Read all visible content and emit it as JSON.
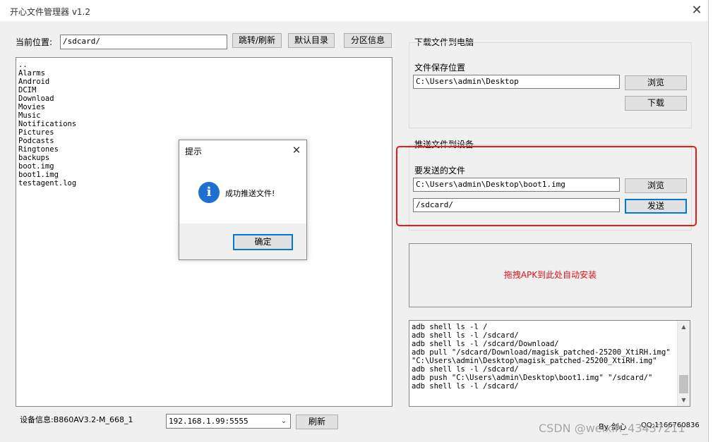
{
  "window": {
    "title": "开心文件管理器  v1.2"
  },
  "location": {
    "label": "当前位置:",
    "path": "/sdcard/",
    "jump_button": "跳转/刷新",
    "default_dir_button": "默认目录",
    "partition_button": "分区信息"
  },
  "file_list": [
    "..",
    "Alarms",
    "Android",
    "DCIM",
    "Download",
    "Movies",
    "Music",
    "Notifications",
    "Pictures",
    "Podcasts",
    "Ringtones",
    "backups",
    "boot.img",
    "boot1.img",
    "testagent.log"
  ],
  "download": {
    "group_title": "下载文件到电脑",
    "save_label": "文件保存位置",
    "save_path": "C:\\Users\\admin\\Desktop",
    "browse_button": "浏览",
    "download_button": "下载"
  },
  "push": {
    "group_title": "推送文件到设备",
    "file_label": "要发送的文件",
    "file_path": "C:\\Users\\admin\\Desktop\\boot1.img",
    "browse_button": "浏览",
    "target_path": "/sdcard/",
    "send_button": "发送"
  },
  "drop_zone_text": "拖拽APK到此处自动安装",
  "log_lines": [
    "adb shell  ls -l  /",
    "adb shell  ls -l  /sdcard/",
    "adb shell  ls -l  /sdcard/Download/",
    "adb pull \"/sdcard/Download/magisk_patched-25200_XtiRH.img\"",
    "\"C:\\Users\\admin\\Desktop\\magisk_patched-25200_XtiRH.img\"",
    "adb shell  ls -l  /sdcard/",
    "adb push \"C:\\Users\\admin\\Desktop\\boot1.img\"  \"/sdcard/\"",
    "adb shell  ls -l  /sdcard/"
  ],
  "device": {
    "label": "设备信息:B860AV3.2-M_668_1",
    "address": "192.168.1.99:5555",
    "refresh_button": "刷新"
  },
  "credits": {
    "by": "By 剑心",
    "qq": "QQ:1166760836"
  },
  "dialog": {
    "title": "提示",
    "icon_glyph": "i",
    "message": "成功推送文件!",
    "ok_button": "确定"
  },
  "watermark": "CSDN @weixin_43437211",
  "colors": {
    "highlight_red": "#e81a1a",
    "drop_text": "#e0101a",
    "info_icon": "#1e6fd1",
    "focus_blue": "#0078d7"
  }
}
